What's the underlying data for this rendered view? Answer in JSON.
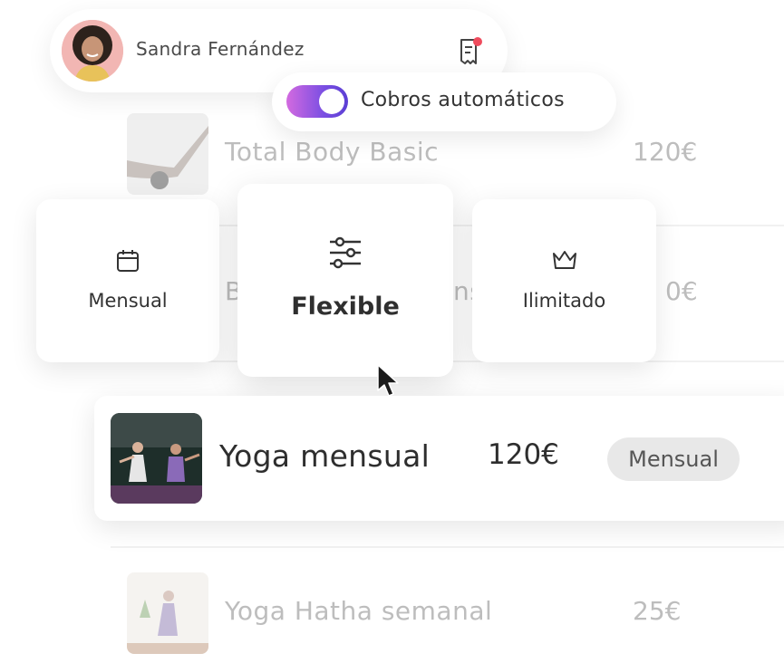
{
  "user": {
    "name": "Sandra Fernández",
    "avatar_icon": "user-avatar",
    "receipt_icon": "receipt-icon",
    "notification_color": "#ef4b5d"
  },
  "auto_billing": {
    "label": "Cobros automáticos",
    "enabled": true,
    "gradient": [
      "#d36ae0",
      "#5b3fd4"
    ]
  },
  "background_list": [
    {
      "name": "Total Body Basic",
      "price": "120€"
    },
    {
      "name": "B",
      "name_tail": "ns",
      "price": "0€"
    },
    {
      "name": "Yoga Hatha semanal",
      "price": "25€"
    }
  ],
  "plans": [
    {
      "label": "Mensual",
      "icon": "calendar-icon"
    },
    {
      "label": "Flexible",
      "icon": "sliders-icon",
      "selected": true
    },
    {
      "label": "Ilimitado",
      "icon": "crown-icon"
    }
  ],
  "featured": {
    "name": "Yoga mensual",
    "price": "120€",
    "badge": "Mensual"
  }
}
